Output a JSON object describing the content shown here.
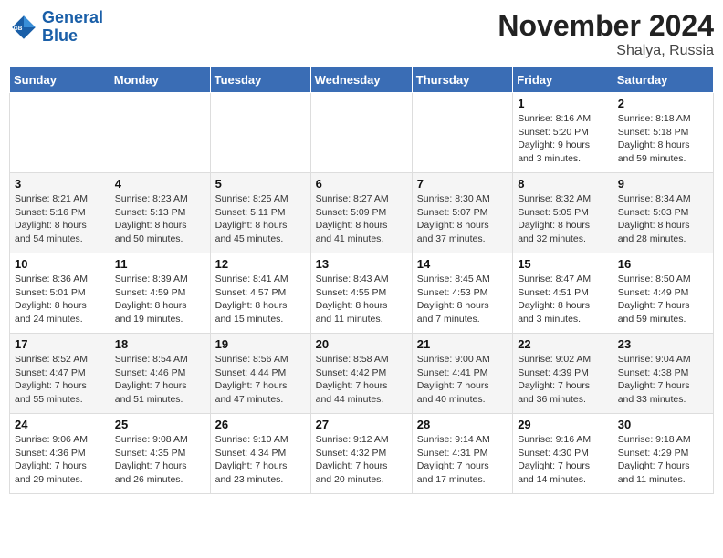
{
  "logo": {
    "line1": "General",
    "line2": "Blue"
  },
  "title": "November 2024",
  "location": "Shalya, Russia",
  "days_header": [
    "Sunday",
    "Monday",
    "Tuesday",
    "Wednesday",
    "Thursday",
    "Friday",
    "Saturday"
  ],
  "weeks": [
    [
      {
        "day": "",
        "detail": ""
      },
      {
        "day": "",
        "detail": ""
      },
      {
        "day": "",
        "detail": ""
      },
      {
        "day": "",
        "detail": ""
      },
      {
        "day": "",
        "detail": ""
      },
      {
        "day": "1",
        "detail": "Sunrise: 8:16 AM\nSunset: 5:20 PM\nDaylight: 9 hours\nand 3 minutes."
      },
      {
        "day": "2",
        "detail": "Sunrise: 8:18 AM\nSunset: 5:18 PM\nDaylight: 8 hours\nand 59 minutes."
      }
    ],
    [
      {
        "day": "3",
        "detail": "Sunrise: 8:21 AM\nSunset: 5:16 PM\nDaylight: 8 hours\nand 54 minutes."
      },
      {
        "day": "4",
        "detail": "Sunrise: 8:23 AM\nSunset: 5:13 PM\nDaylight: 8 hours\nand 50 minutes."
      },
      {
        "day": "5",
        "detail": "Sunrise: 8:25 AM\nSunset: 5:11 PM\nDaylight: 8 hours\nand 45 minutes."
      },
      {
        "day": "6",
        "detail": "Sunrise: 8:27 AM\nSunset: 5:09 PM\nDaylight: 8 hours\nand 41 minutes."
      },
      {
        "day": "7",
        "detail": "Sunrise: 8:30 AM\nSunset: 5:07 PM\nDaylight: 8 hours\nand 37 minutes."
      },
      {
        "day": "8",
        "detail": "Sunrise: 8:32 AM\nSunset: 5:05 PM\nDaylight: 8 hours\nand 32 minutes."
      },
      {
        "day": "9",
        "detail": "Sunrise: 8:34 AM\nSunset: 5:03 PM\nDaylight: 8 hours\nand 28 minutes."
      }
    ],
    [
      {
        "day": "10",
        "detail": "Sunrise: 8:36 AM\nSunset: 5:01 PM\nDaylight: 8 hours\nand 24 minutes."
      },
      {
        "day": "11",
        "detail": "Sunrise: 8:39 AM\nSunset: 4:59 PM\nDaylight: 8 hours\nand 19 minutes."
      },
      {
        "day": "12",
        "detail": "Sunrise: 8:41 AM\nSunset: 4:57 PM\nDaylight: 8 hours\nand 15 minutes."
      },
      {
        "day": "13",
        "detail": "Sunrise: 8:43 AM\nSunset: 4:55 PM\nDaylight: 8 hours\nand 11 minutes."
      },
      {
        "day": "14",
        "detail": "Sunrise: 8:45 AM\nSunset: 4:53 PM\nDaylight: 8 hours\nand 7 minutes."
      },
      {
        "day": "15",
        "detail": "Sunrise: 8:47 AM\nSunset: 4:51 PM\nDaylight: 8 hours\nand 3 minutes."
      },
      {
        "day": "16",
        "detail": "Sunrise: 8:50 AM\nSunset: 4:49 PM\nDaylight: 7 hours\nand 59 minutes."
      }
    ],
    [
      {
        "day": "17",
        "detail": "Sunrise: 8:52 AM\nSunset: 4:47 PM\nDaylight: 7 hours\nand 55 minutes."
      },
      {
        "day": "18",
        "detail": "Sunrise: 8:54 AM\nSunset: 4:46 PM\nDaylight: 7 hours\nand 51 minutes."
      },
      {
        "day": "19",
        "detail": "Sunrise: 8:56 AM\nSunset: 4:44 PM\nDaylight: 7 hours\nand 47 minutes."
      },
      {
        "day": "20",
        "detail": "Sunrise: 8:58 AM\nSunset: 4:42 PM\nDaylight: 7 hours\nand 44 minutes."
      },
      {
        "day": "21",
        "detail": "Sunrise: 9:00 AM\nSunset: 4:41 PM\nDaylight: 7 hours\nand 40 minutes."
      },
      {
        "day": "22",
        "detail": "Sunrise: 9:02 AM\nSunset: 4:39 PM\nDaylight: 7 hours\nand 36 minutes."
      },
      {
        "day": "23",
        "detail": "Sunrise: 9:04 AM\nSunset: 4:38 PM\nDaylight: 7 hours\nand 33 minutes."
      }
    ],
    [
      {
        "day": "24",
        "detail": "Sunrise: 9:06 AM\nSunset: 4:36 PM\nDaylight: 7 hours\nand 29 minutes."
      },
      {
        "day": "25",
        "detail": "Sunrise: 9:08 AM\nSunset: 4:35 PM\nDaylight: 7 hours\nand 26 minutes."
      },
      {
        "day": "26",
        "detail": "Sunrise: 9:10 AM\nSunset: 4:34 PM\nDaylight: 7 hours\nand 23 minutes."
      },
      {
        "day": "27",
        "detail": "Sunrise: 9:12 AM\nSunset: 4:32 PM\nDaylight: 7 hours\nand 20 minutes."
      },
      {
        "day": "28",
        "detail": "Sunrise: 9:14 AM\nSunset: 4:31 PM\nDaylight: 7 hours\nand 17 minutes."
      },
      {
        "day": "29",
        "detail": "Sunrise: 9:16 AM\nSunset: 4:30 PM\nDaylight: 7 hours\nand 14 minutes."
      },
      {
        "day": "30",
        "detail": "Sunrise: 9:18 AM\nSunset: 4:29 PM\nDaylight: 7 hours\nand 11 minutes."
      }
    ]
  ]
}
